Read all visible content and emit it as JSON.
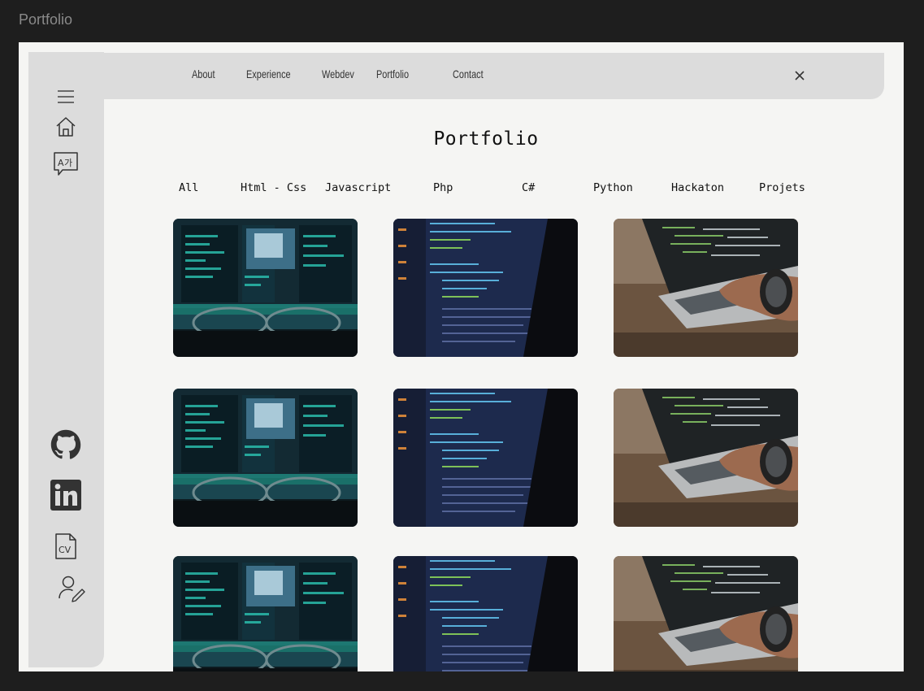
{
  "frame_label": "Portfolio",
  "nav": {
    "links": [
      "About",
      "Experience",
      "Webdev",
      "Portfolio",
      "Contact"
    ]
  },
  "page_title": "Portfolio",
  "filters": [
    "All",
    "Html - Css",
    "Javascript",
    "Php",
    "C#",
    "Python",
    "Hackaton",
    "Projets"
  ],
  "sidebar_icons": [
    "menu-icon",
    "home-icon",
    "language-icon",
    "github-icon",
    "linkedin-icon",
    "cv-icon",
    "user-edit-icon"
  ],
  "cards": [
    {
      "image": "monitor-glasses"
    },
    {
      "image": "code-screen"
    },
    {
      "image": "laptop-typing"
    },
    {
      "image": "monitor-glasses"
    },
    {
      "image": "code-screen"
    },
    {
      "image": "laptop-typing"
    },
    {
      "image": "monitor-glasses"
    },
    {
      "image": "code-screen"
    },
    {
      "image": "laptop-typing"
    }
  ]
}
